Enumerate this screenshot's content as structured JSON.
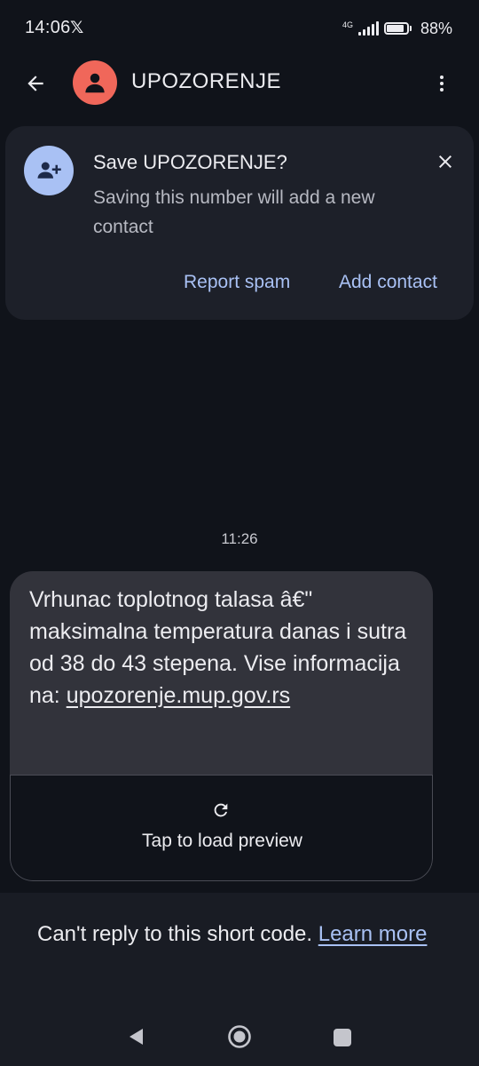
{
  "status_bar": {
    "time": "14:06",
    "app_indicator": "𝕏",
    "network_type": "4G",
    "battery_percent": "88%",
    "battery_level": 0.88
  },
  "app_bar": {
    "title": "UPOZORENJE",
    "back_icon": "arrow-left-icon",
    "more_icon": "more-vert-icon",
    "avatar_color": "#f0675a"
  },
  "save_card": {
    "title": "Save UPOZORENJE?",
    "description": "Saving this number will add a new contact",
    "report_spam_label": "Report spam",
    "add_contact_label": "Add contact",
    "accent_color": "#a9c1f4"
  },
  "message": {
    "time": "11:26",
    "text": "Vrhunac toplotnog talasa â€\" maksimalna temperatura danas i sutra od 38 do 43 stepena. Vise informacija na: ",
    "link": "upozorenje.mup.gov.rs",
    "preview_label": "Tap to load preview"
  },
  "notice": {
    "text": "Can't reply to this short code. ",
    "link": "Learn more"
  },
  "nav_bar": {
    "back": "nav-back-icon",
    "home": "nav-home-icon",
    "recents": "nav-recents-icon"
  }
}
